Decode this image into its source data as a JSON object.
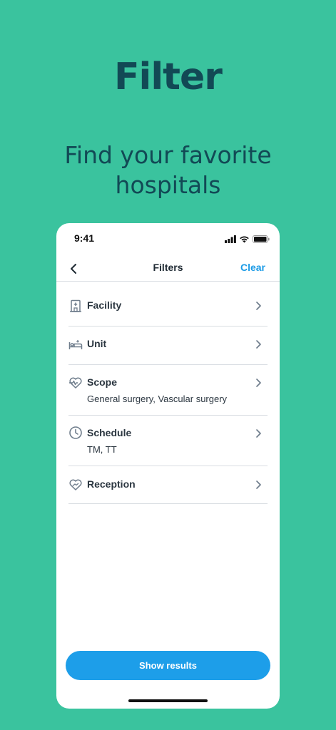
{
  "hero": {
    "title": "Filter",
    "subtitle": "Find your favorite hospitals"
  },
  "status_bar": {
    "time": "9:41",
    "icons": [
      "signal-icon",
      "wifi-icon",
      "battery-icon"
    ]
  },
  "navbar": {
    "back_icon": "chevron-left-icon",
    "title": "Filters",
    "clear_label": "Clear"
  },
  "filters": [
    {
      "label": "Facility",
      "value": "",
      "icon": "hospital-icon"
    },
    {
      "label": "Unit",
      "value": "",
      "icon": "bed-icon"
    },
    {
      "label": "Scope",
      "value": "General surgery, Vascular surgery",
      "icon": "heart-pulse-icon"
    },
    {
      "label": "Schedule",
      "value": "TM, TT",
      "icon": "clock-icon"
    },
    {
      "label": "Reception",
      "value": "",
      "icon": "heart-hand-icon"
    }
  ],
  "cta": {
    "label": "Show results"
  },
  "colors": {
    "background": "#3AC39E",
    "heading": "#124955",
    "accent": "#1D9EE9",
    "text": "#2b3640",
    "icon": "#6f7d8c",
    "divider": "#d9dde2"
  }
}
